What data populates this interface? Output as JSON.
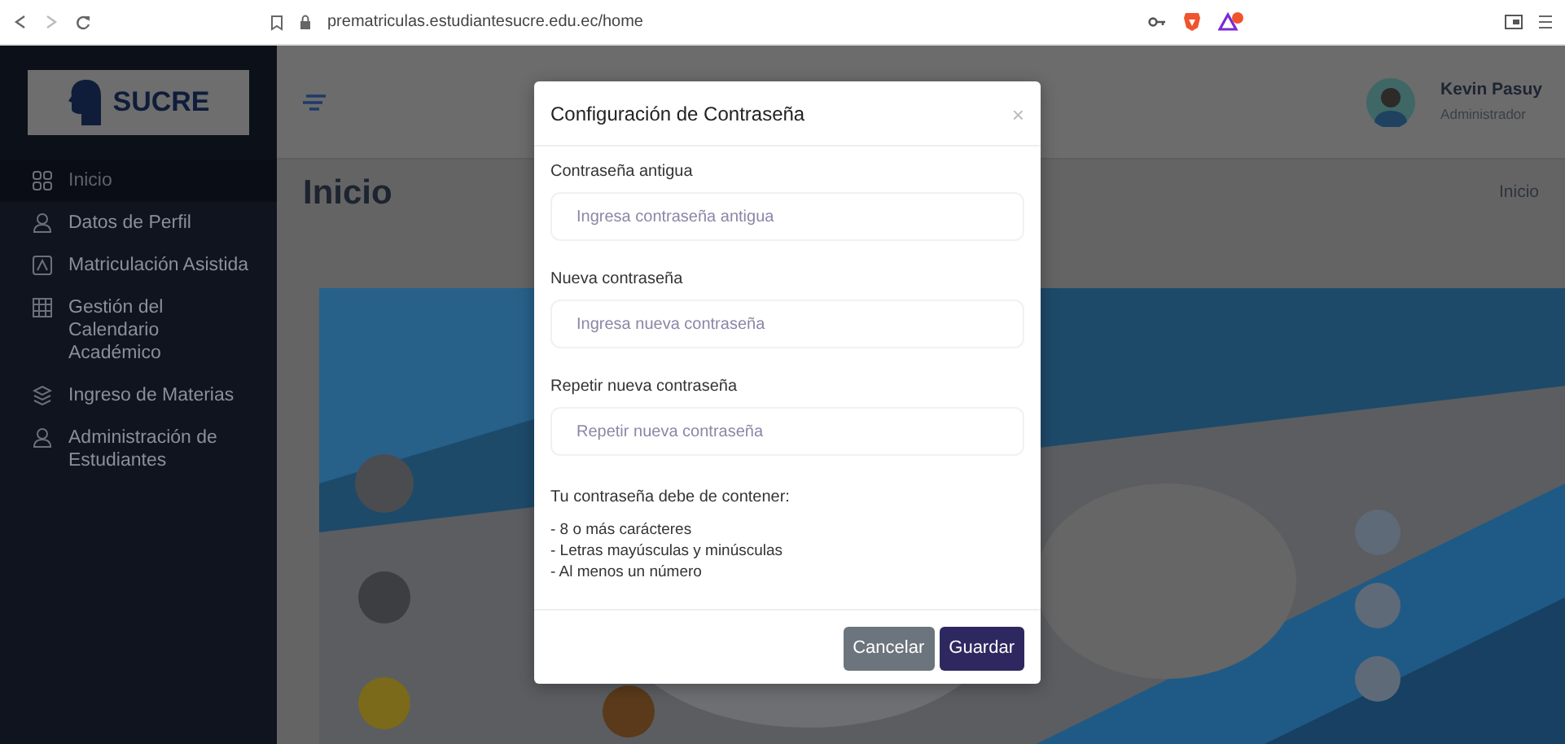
{
  "browser": {
    "url": "prematriculas.estudiantesucre.edu.ec/home"
  },
  "sidebar": {
    "logo": "SUCRE",
    "items": [
      {
        "label": "Inicio",
        "selected": true
      },
      {
        "label": "Datos de Perfil",
        "selected": false
      },
      {
        "label": "Matriculación Asistida",
        "selected": false
      },
      {
        "label": "Gestión del Calendario Académico",
        "selected": false
      },
      {
        "label": "Ingreso de Materias",
        "selected": false
      },
      {
        "label": "Administración de Estudiantes",
        "selected": false
      }
    ]
  },
  "header": {
    "user_name": "Kevin Pasuy",
    "user_role": "Administrador"
  },
  "page": {
    "title": "Inicio",
    "breadcrumb": "Inicio"
  },
  "modal": {
    "title": "Configuración de Contraseña",
    "close": "×",
    "fields": [
      {
        "label": "Contraseña antigua",
        "placeholder": "Ingresa contraseña antigua"
      },
      {
        "label": "Nueva contraseña",
        "placeholder": "Ingresa nueva contraseña"
      },
      {
        "label": "Repetir nueva contraseña",
        "placeholder": "Repetir nueva contraseña"
      }
    ],
    "requirements_title": "Tu contraseña debe de contener:",
    "requirements": [
      "- 8 o más carácteres",
      "- Letras mayúsculas y minúsculas",
      "- Al menos un número"
    ],
    "buttons": [
      {
        "label": "Cancelar",
        "kind": "secondary"
      },
      {
        "label": "Guardar",
        "kind": "primary"
      }
    ]
  }
}
